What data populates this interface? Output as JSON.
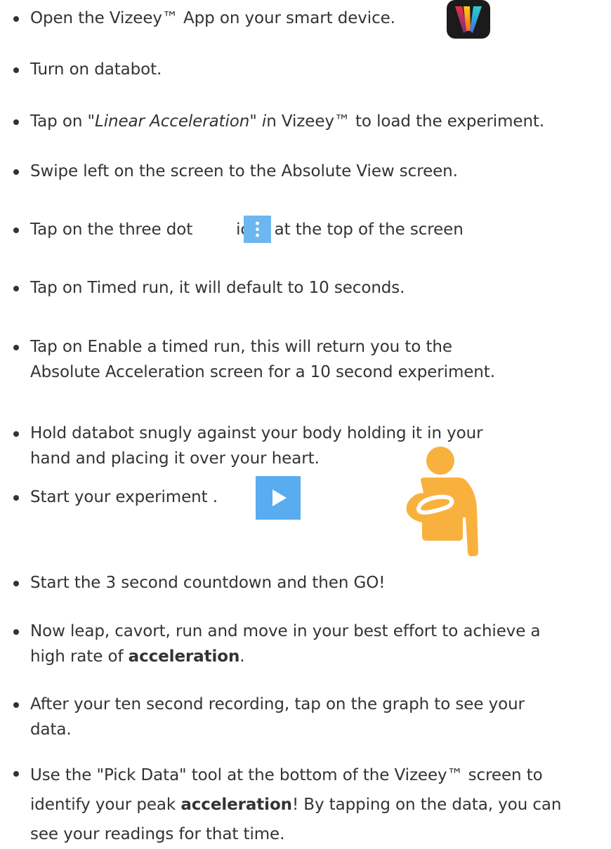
{
  "steps": [
    {
      "text": "Open the Vizeey™ App on your smart device."
    },
    {
      "text": "Turn on databot."
    },
    {
      "before": "Tap on \"",
      "italic": "Linear Acceleration\" i",
      "after": "n Vizeey™ to load the experiment."
    },
    {
      "text": "Swipe left on the screen to the Absolute View screen."
    },
    {
      "before": "Tap on the three dot",
      "after": "icon at the top of the screen"
    },
    {
      "text": "Tap on Timed run, it will default to 10 seconds."
    },
    {
      "line1": "Tap on Enable a timed run, this will return you to the",
      "line2": "Absolute Acceleration screen for a 10 second experiment."
    },
    {
      "line1": "Hold databot snugly against your body holding it in your",
      "line2": "hand and placing it over your heart."
    },
    {
      "text": "Start your experiment ."
    },
    {
      "text": "Start the 3 second countdown and then GO!"
    },
    {
      "line1": "Now leap, cavort, run and move in your best effort to achieve a",
      "line2_before": "high rate of ",
      "line2_bold": "acceleration",
      "line2_after": "."
    },
    {
      "line1": "After your ten second recording, tap on the graph to see your",
      "line2": "data."
    },
    {
      "line1": "Use the \"Pick Data\" tool at the bottom of the Vizeey™ screen to",
      "line2_before": "identify your peak ",
      "line2_bold": "acceleration",
      "line2_after": "! By tapping on the data, you can",
      "line3": "see your readings for that time."
    }
  ],
  "icons": {
    "app_icon": "vizeey-app-icon",
    "three_dot_icon": "three-dot-menu-icon",
    "play_icon": "play-button-icon",
    "person_icon": "hand-on-heart-person-icon"
  },
  "colors": {
    "text": "#333333",
    "dots_bg": "#6cb7ef",
    "play_bg": "#58acef",
    "person": "#f9b13e",
    "app_bg": "#1b1b1b"
  }
}
